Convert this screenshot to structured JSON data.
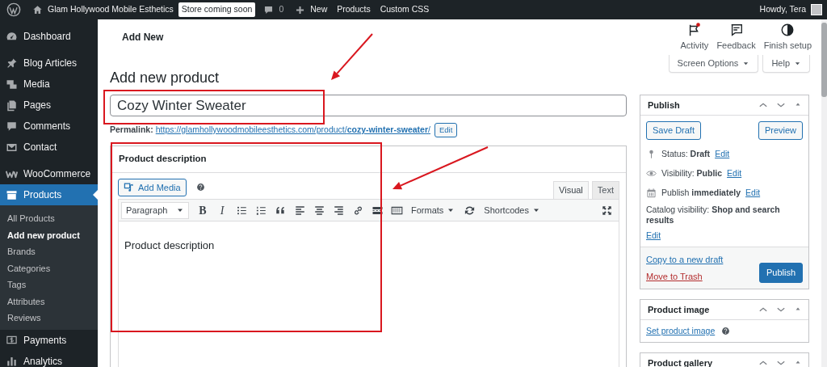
{
  "admin_bar": {
    "site_name": "Glam Hollywood Mobile Esthetics",
    "badge": "Store coming soon",
    "comments_count": "0",
    "new_label": "New",
    "links": [
      "Products",
      "Custom CSS"
    ],
    "greeting": "Howdy, Tera"
  },
  "sidebar": {
    "groups": [
      [
        {
          "label": "Dashboard",
          "selected": false
        }
      ],
      [
        {
          "label": "Blog Articles",
          "selected": false
        },
        {
          "label": "Media",
          "selected": false
        },
        {
          "label": "Pages",
          "selected": false
        },
        {
          "label": "Comments",
          "selected": false
        },
        {
          "label": "Contact",
          "selected": false
        }
      ],
      [
        {
          "label": "WooCommerce",
          "selected": false
        },
        {
          "label": "Products",
          "selected": true,
          "children": [
            {
              "label": "All Products",
              "selected": false
            },
            {
              "label": "Add new product",
              "selected": true
            },
            {
              "label": "Brands",
              "selected": false
            },
            {
              "label": "Categories",
              "selected": false
            },
            {
              "label": "Tags",
              "selected": false
            },
            {
              "label": "Attributes",
              "selected": false
            },
            {
              "label": "Reviews",
              "selected": false
            }
          ]
        },
        {
          "label": "Payments",
          "selected": false
        },
        {
          "label": "Analytics",
          "selected": false
        }
      ]
    ]
  },
  "header": {
    "breadcrumb": "Add New",
    "actions": [
      {
        "label": "Activity",
        "unread": true
      },
      {
        "label": "Feedback",
        "unread": false
      },
      {
        "label": "Finish setup",
        "unread": false
      }
    ],
    "screen_tabs": [
      "Screen Options",
      "Help"
    ]
  },
  "page_title": "Add new product",
  "title_field": {
    "value": "Cozy Winter Sweater"
  },
  "permalink": {
    "label": "Permalink:",
    "url": "https://glamhollywoodmobileesthetics.com/product/**cozy-winter-sweater**/",
    "edit": "Edit"
  },
  "description_box": {
    "title": "Product description",
    "add_media": "Add Media",
    "editor_tabs": [
      {
        "label": "Visual",
        "selected": true
      },
      {
        "label": "Text",
        "selected": false
      }
    ],
    "toolbar": [
      {
        "kind": "select",
        "label": "Paragraph"
      },
      {
        "kind": "bold",
        "label": "B"
      },
      {
        "kind": "italic",
        "label": "I"
      },
      {
        "kind": "bullet-list"
      },
      {
        "kind": "numbered-list"
      },
      {
        "kind": "quote"
      },
      {
        "kind": "align-left"
      },
      {
        "kind": "align-center"
      },
      {
        "kind": "align-right"
      },
      {
        "kind": "link"
      },
      {
        "kind": "read-more"
      },
      {
        "kind": "toolbar-toggle"
      },
      {
        "kind": "dropdown",
        "label": "Formats"
      },
      {
        "kind": "refresh"
      },
      {
        "kind": "dropdown",
        "label": "Shortcodes"
      },
      {
        "kind": "fullscreen"
      }
    ],
    "content": "Product description"
  },
  "publish_box": {
    "title": "Publish",
    "save_draft": "Save Draft",
    "preview": "Preview",
    "rows": [
      {
        "kind": "status",
        "label": "Status: **Draft**",
        "edit": "Edit"
      },
      {
        "kind": "visibility",
        "label": "Visibility: **Public**",
        "edit": "Edit"
      },
      {
        "kind": "schedule",
        "label": "Publish **immediately**",
        "edit": "Edit"
      },
      {
        "kind": "catalog",
        "label": "Catalog visibility: **Shop and search results**",
        "edit": "Edit"
      }
    ],
    "copy_link": "Copy to a new draft",
    "trash_link": "Move to Trash",
    "publish_button": "Publish"
  },
  "side_boxes": [
    {
      "title": "Product image",
      "link": "Set product image"
    },
    {
      "title": "Product gallery"
    }
  ],
  "annotations": [
    {
      "kind": "frame"
    },
    {
      "kind": "frame"
    },
    {
      "kind": "arrow"
    },
    {
      "kind": "arrow"
    }
  ]
}
